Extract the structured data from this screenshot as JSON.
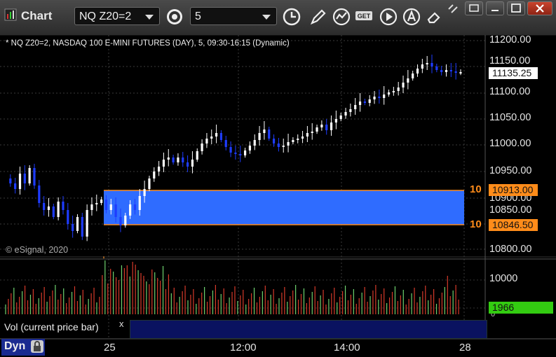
{
  "window": {
    "title": "Chart",
    "symbol_value": "NQ Z20=2",
    "interval_value": "5"
  },
  "chart": {
    "caption": "* NQ Z20=2, NASDAQ 100 E-MINI FUTURES (DAY), 5, 09:30-16:15 (Dynamic)",
    "copyright": "© eSignal, 2020",
    "price_axis": [
      "11200.00",
      "11150.00",
      "11100.00",
      "11050.00",
      "11000.00",
      "10950.00",
      "10900.00",
      "10850.00",
      "10800.00"
    ],
    "current_price": "11135.25",
    "upper_level": "10913.00",
    "lower_level": "10846.50",
    "level_edge_mark": "10",
    "time_axis": [
      "25",
      "12:00",
      "14:00",
      "28"
    ],
    "colors": {
      "up_candle": "#ffffff",
      "down_candle": "#1e3cff",
      "zone_fill": "#2f6cff",
      "zone_line": "#ff8c1a",
      "current_tag": "#ffffff",
      "level_tag": "#ff8c1a",
      "volume_tag": "#33cc11",
      "volume_up": "#6fd36f",
      "volume_down": "#d63a2a"
    }
  },
  "volume": {
    "axis_top": "10000",
    "axis_small": "0",
    "current": "1966",
    "label": "Vol (current price bar)",
    "close_glyph": "x"
  },
  "footer": {
    "layout_label": "Dyn"
  },
  "icons": [
    "settings-icon",
    "clock-icon",
    "pencil-icon",
    "study-icon",
    "get-icon",
    "play-icon",
    "alert-icon",
    "eraser-icon",
    "link-icon",
    "restore-icon",
    "maximize-icon",
    "close-icon",
    "lock-icon"
  ]
}
